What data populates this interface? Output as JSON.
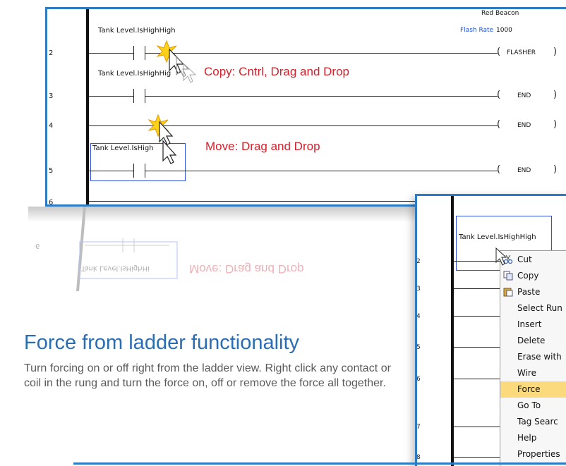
{
  "top_ladder": {
    "rungs": [
      {
        "number": "2",
        "contact_tag": "Tank Level.IsHighHigh",
        "coil": "FLASHER",
        "coil_label_top": "Red Beacon",
        "coil_label_param": "Flash Rate",
        "coil_label_value": "1000"
      },
      {
        "number": "3",
        "contact_tag": "Tank Level.IsHighHig",
        "coil": "END"
      },
      {
        "number": "4",
        "coil": "END"
      },
      {
        "number": "5",
        "contact_tag": "Tank Level.IsHigh",
        "coil": "END"
      },
      {
        "number": "6"
      }
    ],
    "callouts": {
      "copy": "Copy: Cntrl, Drag and Drop",
      "move": "Move: Drag and Drop"
    }
  },
  "reflection": {
    "tag": "Tank Level.IsHighHi",
    "callout": "Move: Drag and Drop",
    "rung": "6"
  },
  "feature": {
    "title": "Force from ladder functionality",
    "description": "Turn forcing on or off right from the ladder view. Right click any contact or coil in the rung and turn the force on, off or remove the force all together."
  },
  "bottom_ladder": {
    "contact_tag": "Tank Level.IsHighHigh",
    "rung_numbers": [
      "2",
      "3",
      "4",
      "5",
      "6",
      "7",
      "8"
    ]
  },
  "context_menu": {
    "items": [
      {
        "label": "Cut",
        "icon": "cut-icon"
      },
      {
        "label": "Copy",
        "icon": "copy-icon"
      },
      {
        "label": "Paste",
        "icon": "paste-icon"
      },
      {
        "label": "Select Run"
      },
      {
        "label": "Insert"
      },
      {
        "label": "Delete"
      },
      {
        "label": "Erase with"
      },
      {
        "label": "Wire"
      },
      {
        "label": "Force",
        "highlighted": true
      },
      {
        "label": "Go To"
      },
      {
        "label": "Tag Searc"
      },
      {
        "label": "Help"
      },
      {
        "label": "Properties"
      }
    ]
  },
  "colors": {
    "accent": "#2d7cc3",
    "callout": "#d4202b",
    "heading": "#2b6db3",
    "body_text": "#5a5a5a",
    "menu_highlight": "#fbd97d"
  }
}
